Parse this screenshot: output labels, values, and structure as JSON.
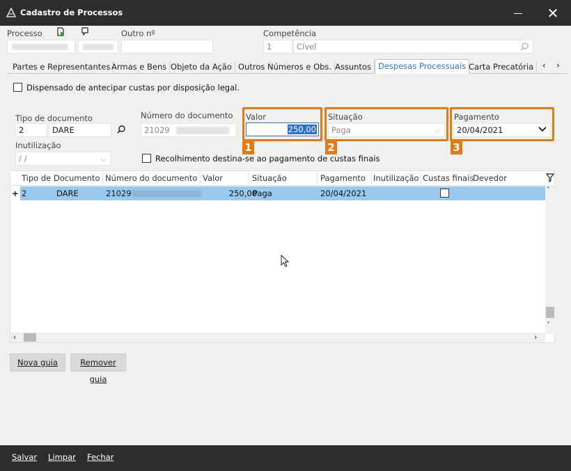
{
  "window": {
    "title": "Cadastro de Processos"
  },
  "header": {
    "processo_label": "Processo",
    "outro_label": "Outro nº",
    "competencia_label": "Competência",
    "competencia_code": "1",
    "competencia_value": "Cível"
  },
  "tabs": [
    "Partes e Representantes",
    "Armas e Bens",
    "Objeto da Ação",
    "Outros Números e Obs.",
    "Assuntos",
    "Despesas Processuais",
    "Carta Precatória"
  ],
  "active_tab": "Despesas Processuais",
  "form": {
    "dispensado_label": "Dispensado de antecipar custas por disposição legal.",
    "tipo_label": "Tipo de documento",
    "tipo_code": "2",
    "tipo_value": "DARE",
    "numero_label": "Número do documento",
    "numero_value": "21029",
    "valor_label": "Valor",
    "valor_value": "250,00",
    "situacao_label": "Situação",
    "situacao_value": "Paga",
    "pagamento_label": "Pagamento",
    "pagamento_value": "20/04/2021",
    "inutilizacao_label": "Inutilização",
    "inutilizacao_value": "/ /",
    "recolhimento_label": "Recolhimento destina-se ao pagamento de custas finais"
  },
  "annotations": {
    "one": "1",
    "two": "2",
    "three": "3"
  },
  "grid": {
    "columns": [
      "Tipo de Documento",
      "Número do documento",
      "Valor",
      "Situação",
      "Pagamento",
      "Inutilização",
      "Custas finais",
      "Devedor"
    ],
    "rows": [
      {
        "marker": "+",
        "code": "2",
        "tipo": "DARE",
        "numero": "21029",
        "valor": "250,00",
        "situacao": "Paga",
        "pagamento": "20/04/2021",
        "inutilizacao": "",
        "custas_finais": false,
        "devedor": ""
      }
    ]
  },
  "buttons": {
    "nova_guia": "Nova guia",
    "remover_guia": "Remover guia"
  },
  "footer": {
    "salvar": "Salvar",
    "limpar": "Limpar",
    "fechar": "Fechar"
  },
  "colors": {
    "accent": "#e07b17",
    "selection": "#99c9ef",
    "tab_active": "#2a73c6",
    "titlebar": "#2d2d2d"
  }
}
